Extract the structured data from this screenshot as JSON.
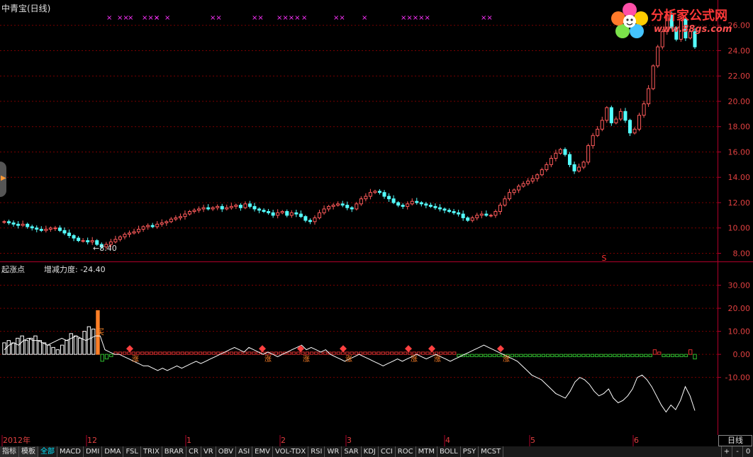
{
  "window": {
    "title": "中青宝(日线)"
  },
  "logo": {
    "title": "分析家公式网",
    "url": "www.88gs.com"
  },
  "indicator": {
    "name": "起涨点",
    "value_text": "增减力度: -24.40"
  },
  "price_annotation": {
    "low_label": "←8.40",
    "buy_label": "买",
    "up_label": "涨"
  },
  "colors": {
    "up": "#ff5a5a",
    "down": "#54ffff",
    "grid": "#7a0000",
    "axis": "#b0002a",
    "cross": "#ff33ff",
    "buy": "#ff7f27",
    "line": "#ffffff",
    "green": "#30c030",
    "red": "#e03030"
  },
  "cross_marks": [
    {
      "index": 1,
      "text": "×"
    },
    {
      "index": 2,
      "text": "××"
    },
    {
      "index": 3,
      "text": "×"
    },
    {
      "index": 4,
      "text": "×××"
    },
    {
      "index": 5,
      "text": "×"
    },
    {
      "index": 6,
      "text": "×"
    },
    {
      "index": 7,
      "text": "××"
    },
    {
      "index": 8,
      "text": "××"
    },
    {
      "index": 9,
      "text": "××××"
    },
    {
      "index": 10,
      "text": "×"
    },
    {
      "index": 11,
      "text": "××"
    },
    {
      "index": 12,
      "text": "×"
    },
    {
      "index": 13,
      "text": "×××××"
    },
    {
      "index": 14,
      "text": "××"
    }
  ],
  "s_mark": {
    "text": "S"
  },
  "chart_data": [
    {
      "type": "candlestick",
      "title": "中青宝(日线)",
      "ylim": [
        7.3,
        28
      ],
      "yticks": [
        8.0,
        10.0,
        12.0,
        14.0,
        16.0,
        18.0,
        20.0,
        22.0,
        24.0,
        26.0
      ],
      "ytick_labels": [
        "8.00",
        "10.00",
        "12.00",
        "14.00",
        "16.00",
        "18.00",
        "20.00",
        "22.00",
        "24.00",
        "26.00"
      ],
      "grid": true,
      "x_labels": [
        "2012年",
        "12",
        "1",
        "2",
        "3",
        "4",
        "5",
        "6"
      ],
      "annotations": [
        "←8.40"
      ],
      "closes": [
        10.5,
        10.4,
        10.3,
        10.2,
        10.3,
        10.1,
        10.0,
        9.9,
        9.8,
        9.9,
        10.0,
        10.0,
        9.8,
        9.6,
        9.4,
        9.2,
        9.0,
        9.0,
        8.9,
        9.0,
        8.7,
        8.5,
        8.7,
        8.9,
        9.1,
        9.3,
        9.5,
        9.6,
        9.7,
        9.9,
        10.1,
        10.2,
        10.1,
        10.3,
        10.4,
        10.5,
        10.7,
        10.8,
        10.9,
        11.1,
        11.3,
        11.4,
        11.5,
        11.6,
        11.5,
        11.6,
        11.7,
        11.5,
        11.6,
        11.7,
        11.8,
        11.6,
        11.9,
        11.7,
        11.5,
        11.4,
        11.3,
        11.2,
        11.0,
        11.2,
        11.3,
        11.0,
        11.2,
        11.1,
        10.9,
        10.6,
        10.5,
        10.8,
        11.2,
        11.5,
        11.7,
        11.8,
        11.9,
        11.8,
        11.6,
        11.5,
        11.9,
        12.3,
        12.5,
        12.8,
        12.9,
        12.8,
        12.5,
        12.3,
        12.0,
        11.8,
        11.7,
        11.9,
        12.1,
        12.0,
        11.9,
        11.8,
        11.7,
        11.6,
        11.5,
        11.4,
        11.3,
        11.2,
        11.1,
        10.8,
        10.6,
        10.8,
        11.0,
        11.1,
        11.0,
        11.0,
        11.3,
        11.8,
        12.3,
        12.8,
        13.0,
        13.3,
        13.5,
        13.7,
        13.9,
        14.2,
        14.6,
        15.0,
        15.5,
        15.9,
        16.2,
        15.8,
        15.0,
        14.5,
        14.8,
        15.2,
        16.5,
        17.3,
        17.8,
        18.5,
        19.5,
        18.3,
        18.6,
        19.2,
        18.5,
        17.5,
        17.8,
        18.9,
        19.8,
        21.0,
        22.8,
        24.3,
        25.5,
        26.8,
        25.8,
        24.9,
        26.5,
        25.0,
        25.5,
        24.3
      ],
      "series_note": "daily candles; red = up, cyan = down"
    },
    {
      "type": "bar+line",
      "title": "起涨点",
      "ylim": [
        -35,
        40
      ],
      "yticks": [
        -10.0,
        0.0,
        10.0,
        20.0,
        30.0
      ],
      "ytick_labels": [
        "-10.00",
        "0.00",
        "10.00",
        "20.00",
        "30.00"
      ],
      "grid": true,
      "annotations": [
        "增减力度: -24.40",
        "买",
        "涨"
      ],
      "bars": [
        5,
        6,
        5,
        7,
        8,
        6,
        7,
        8,
        6,
        5,
        4,
        3,
        2,
        4,
        6,
        9,
        8,
        7,
        10,
        12,
        11,
        19,
        -3,
        -2,
        -1,
        1,
        1,
        1,
        1,
        1,
        1,
        1,
        1,
        1,
        1,
        1,
        1,
        1,
        1,
        1,
        1,
        1,
        1,
        1,
        1,
        1,
        1,
        1,
        1,
        1,
        1,
        1,
        1,
        1,
        1,
        1,
        1,
        1,
        1,
        1,
        1,
        1,
        1,
        1,
        1,
        1,
        1,
        1,
        1,
        1,
        1,
        1,
        1,
        1,
        1,
        1,
        1,
        1,
        1,
        1,
        1,
        1,
        1,
        1,
        1,
        1,
        1,
        1,
        1,
        1,
        1,
        1,
        1,
        1,
        1,
        1,
        1,
        1,
        1,
        1,
        1,
        1,
        -1,
        -1,
        -1,
        -1,
        -1,
        -1,
        -1,
        -1,
        -1,
        -1,
        -1,
        -1,
        -1,
        -1,
        -1,
        -1,
        -1,
        -1,
        -1,
        -1,
        -1,
        -1,
        -1,
        -1,
        -1,
        -1,
        -1,
        -1,
        -1,
        -1,
        -1,
        -1,
        -1,
        -1,
        -1,
        -1,
        -1,
        -1,
        -1,
        -1,
        -1,
        -1,
        -1,
        -1,
        2,
        1,
        -1,
        -1,
        -1,
        -1,
        -1,
        -1,
        2,
        -2
      ],
      "line": [
        2,
        4,
        5,
        4,
        6,
        7,
        6,
        6,
        5,
        4,
        5,
        6,
        7,
        6,
        7,
        8,
        7,
        6,
        7,
        8,
        8,
        2,
        1,
        0,
        0,
        -1,
        -2,
        -3,
        -4,
        -5,
        -5,
        -6,
        -7,
        -6,
        -7,
        -6,
        -5,
        -6,
        -5,
        -4,
        -3,
        -4,
        -3,
        -2,
        -1,
        0,
        1,
        2,
        3,
        2,
        1,
        3,
        2,
        1,
        0,
        1,
        0,
        -1,
        0,
        1,
        2,
        3,
        4,
        2,
        3,
        2,
        1,
        2,
        0,
        -1,
        -2,
        -3,
        -2,
        -1,
        0,
        -1,
        -2,
        -3,
        -4,
        -5,
        -4,
        -3,
        -2,
        -3,
        -2,
        -1,
        0,
        -1,
        -2,
        -1,
        0,
        -1,
        -2,
        -3,
        -2,
        -1,
        0,
        1,
        2,
        3,
        4,
        3,
        2,
        1,
        0,
        -1,
        -2,
        -3,
        -5,
        -7,
        -9,
        -10,
        -11,
        -13,
        -15,
        -17,
        -18,
        -19,
        -16,
        -12,
        -10,
        -11,
        -13,
        -16,
        -18,
        -17,
        -15,
        -19,
        -21,
        -20,
        -18,
        -15,
        -10,
        -9,
        -11,
        -14,
        -18,
        -22,
        -25,
        -22,
        -24,
        -20,
        -14,
        -18,
        -24.4
      ]
    }
  ],
  "date_bar": {
    "range_label": "日线"
  },
  "tabs": [
    "指标",
    "模板",
    "全部",
    "MACD",
    "DMI",
    "DMA",
    "FSL",
    "TRIX",
    "BRAR",
    "CR",
    "VR",
    "OBV",
    "ASI",
    "EMV",
    "VOL-TDX",
    "RSI",
    "WR",
    "SAR",
    "KDJ",
    "CCI",
    "ROC",
    "MTM",
    "BOLL",
    "PSY",
    "MCST"
  ],
  "controls": [
    "+",
    "-",
    "0"
  ]
}
